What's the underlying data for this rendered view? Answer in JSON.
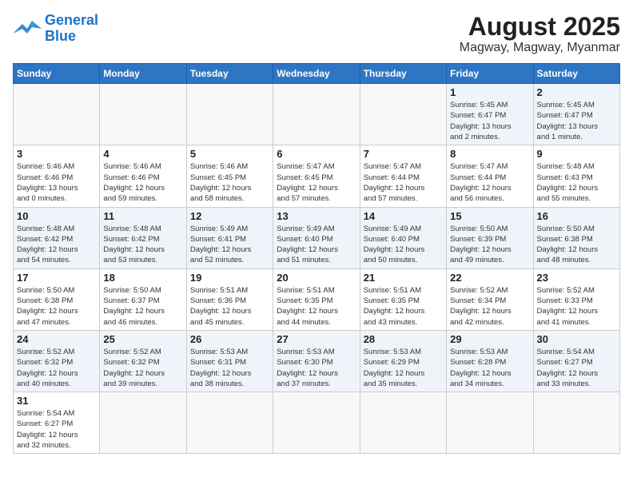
{
  "header": {
    "logo_general": "General",
    "logo_blue": "Blue",
    "title": "August 2025",
    "subtitle": "Magway, Magway, Myanmar"
  },
  "weekdays": [
    "Sunday",
    "Monday",
    "Tuesday",
    "Wednesday",
    "Thursday",
    "Friday",
    "Saturday"
  ],
  "weeks": [
    [
      {
        "day": "",
        "info": ""
      },
      {
        "day": "",
        "info": ""
      },
      {
        "day": "",
        "info": ""
      },
      {
        "day": "",
        "info": ""
      },
      {
        "day": "",
        "info": ""
      },
      {
        "day": "1",
        "info": "Sunrise: 5:45 AM\nSunset: 6:47 PM\nDaylight: 13 hours\nand 2 minutes."
      },
      {
        "day": "2",
        "info": "Sunrise: 5:45 AM\nSunset: 6:47 PM\nDaylight: 13 hours\nand 1 minute."
      }
    ],
    [
      {
        "day": "3",
        "info": "Sunrise: 5:46 AM\nSunset: 6:46 PM\nDaylight: 13 hours\nand 0 minutes."
      },
      {
        "day": "4",
        "info": "Sunrise: 5:46 AM\nSunset: 6:46 PM\nDaylight: 12 hours\nand 59 minutes."
      },
      {
        "day": "5",
        "info": "Sunrise: 5:46 AM\nSunset: 6:45 PM\nDaylight: 12 hours\nand 58 minutes."
      },
      {
        "day": "6",
        "info": "Sunrise: 5:47 AM\nSunset: 6:45 PM\nDaylight: 12 hours\nand 57 minutes."
      },
      {
        "day": "7",
        "info": "Sunrise: 5:47 AM\nSunset: 6:44 PM\nDaylight: 12 hours\nand 57 minutes."
      },
      {
        "day": "8",
        "info": "Sunrise: 5:47 AM\nSunset: 6:44 PM\nDaylight: 12 hours\nand 56 minutes."
      },
      {
        "day": "9",
        "info": "Sunrise: 5:48 AM\nSunset: 6:43 PM\nDaylight: 12 hours\nand 55 minutes."
      }
    ],
    [
      {
        "day": "10",
        "info": "Sunrise: 5:48 AM\nSunset: 6:42 PM\nDaylight: 12 hours\nand 54 minutes."
      },
      {
        "day": "11",
        "info": "Sunrise: 5:48 AM\nSunset: 6:42 PM\nDaylight: 12 hours\nand 53 minutes."
      },
      {
        "day": "12",
        "info": "Sunrise: 5:49 AM\nSunset: 6:41 PM\nDaylight: 12 hours\nand 52 minutes."
      },
      {
        "day": "13",
        "info": "Sunrise: 5:49 AM\nSunset: 6:40 PM\nDaylight: 12 hours\nand 51 minutes."
      },
      {
        "day": "14",
        "info": "Sunrise: 5:49 AM\nSunset: 6:40 PM\nDaylight: 12 hours\nand 50 minutes."
      },
      {
        "day": "15",
        "info": "Sunrise: 5:50 AM\nSunset: 6:39 PM\nDaylight: 12 hours\nand 49 minutes."
      },
      {
        "day": "16",
        "info": "Sunrise: 5:50 AM\nSunset: 6:38 PM\nDaylight: 12 hours\nand 48 minutes."
      }
    ],
    [
      {
        "day": "17",
        "info": "Sunrise: 5:50 AM\nSunset: 6:38 PM\nDaylight: 12 hours\nand 47 minutes."
      },
      {
        "day": "18",
        "info": "Sunrise: 5:50 AM\nSunset: 6:37 PM\nDaylight: 12 hours\nand 46 minutes."
      },
      {
        "day": "19",
        "info": "Sunrise: 5:51 AM\nSunset: 6:36 PM\nDaylight: 12 hours\nand 45 minutes."
      },
      {
        "day": "20",
        "info": "Sunrise: 5:51 AM\nSunset: 6:35 PM\nDaylight: 12 hours\nand 44 minutes."
      },
      {
        "day": "21",
        "info": "Sunrise: 5:51 AM\nSunset: 6:35 PM\nDaylight: 12 hours\nand 43 minutes."
      },
      {
        "day": "22",
        "info": "Sunrise: 5:52 AM\nSunset: 6:34 PM\nDaylight: 12 hours\nand 42 minutes."
      },
      {
        "day": "23",
        "info": "Sunrise: 5:52 AM\nSunset: 6:33 PM\nDaylight: 12 hours\nand 41 minutes."
      }
    ],
    [
      {
        "day": "24",
        "info": "Sunrise: 5:52 AM\nSunset: 6:32 PM\nDaylight: 12 hours\nand 40 minutes."
      },
      {
        "day": "25",
        "info": "Sunrise: 5:52 AM\nSunset: 6:32 PM\nDaylight: 12 hours\nand 39 minutes."
      },
      {
        "day": "26",
        "info": "Sunrise: 5:53 AM\nSunset: 6:31 PM\nDaylight: 12 hours\nand 38 minutes."
      },
      {
        "day": "27",
        "info": "Sunrise: 5:53 AM\nSunset: 6:30 PM\nDaylight: 12 hours\nand 37 minutes."
      },
      {
        "day": "28",
        "info": "Sunrise: 5:53 AM\nSunset: 6:29 PM\nDaylight: 12 hours\nand 35 minutes."
      },
      {
        "day": "29",
        "info": "Sunrise: 5:53 AM\nSunset: 6:28 PM\nDaylight: 12 hours\nand 34 minutes."
      },
      {
        "day": "30",
        "info": "Sunrise: 5:54 AM\nSunset: 6:27 PM\nDaylight: 12 hours\nand 33 minutes."
      }
    ],
    [
      {
        "day": "31",
        "info": "Sunrise: 5:54 AM\nSunset: 6:27 PM\nDaylight: 12 hours\nand 32 minutes."
      },
      {
        "day": "",
        "info": ""
      },
      {
        "day": "",
        "info": ""
      },
      {
        "day": "",
        "info": ""
      },
      {
        "day": "",
        "info": ""
      },
      {
        "day": "",
        "info": ""
      },
      {
        "day": "",
        "info": ""
      }
    ]
  ]
}
